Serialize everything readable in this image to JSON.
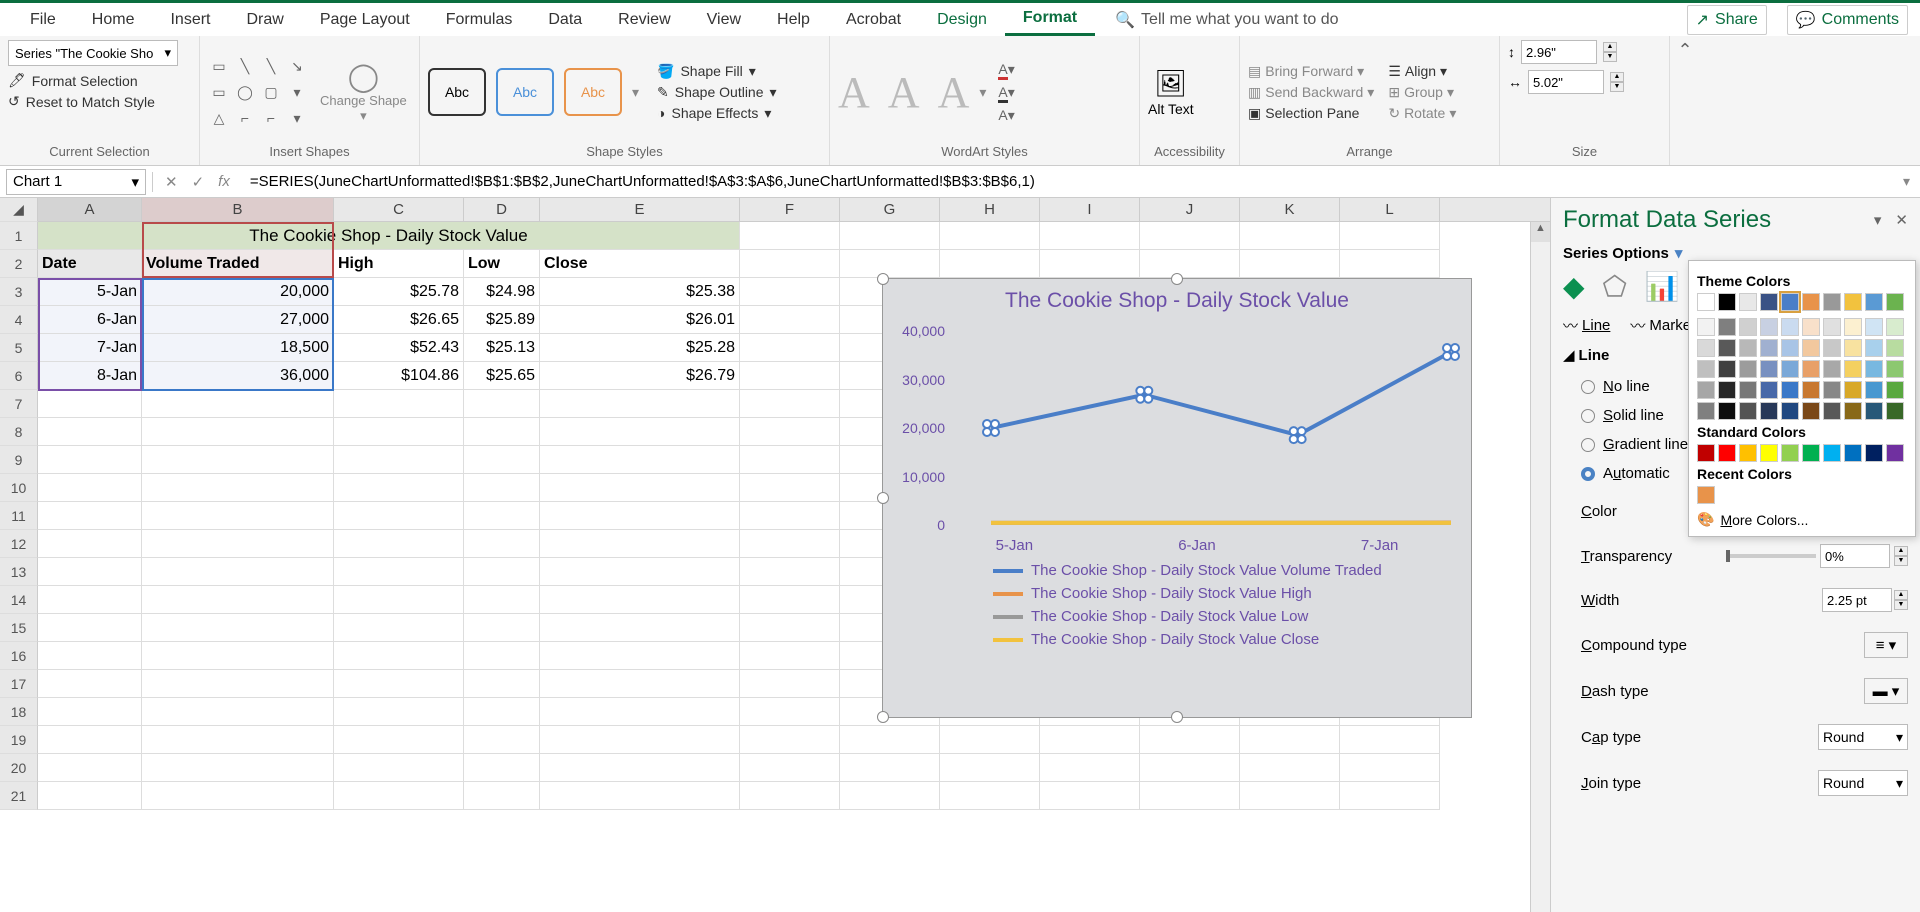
{
  "menu": {
    "items": [
      "File",
      "Home",
      "Insert",
      "Draw",
      "Page Layout",
      "Formulas",
      "Data",
      "Review",
      "View",
      "Help",
      "Acrobat",
      "Design",
      "Format"
    ],
    "tell_me": "Tell me what you want to do",
    "share": "Share",
    "comments": "Comments"
  },
  "ribbon": {
    "current_selection": {
      "label": "Current Selection",
      "dropdown": "Series \"The Cookie Sho",
      "format": "Format Selection",
      "reset": "Reset to Match Style"
    },
    "insert_shapes": {
      "label": "Insert Shapes",
      "change": "Change Shape"
    },
    "shape_styles": {
      "label": "Shape Styles",
      "abc": "Abc",
      "fill": "Shape Fill",
      "outline": "Shape Outline",
      "effects": "Shape Effects"
    },
    "wordart": {
      "label": "WordArt Styles"
    },
    "accessibility": {
      "label": "Accessibility",
      "alt": "Alt Text"
    },
    "arrange": {
      "label": "Arrange",
      "forward": "Bring Forward",
      "backward": "Send Backward",
      "pane": "Selection Pane",
      "align": "Align",
      "group": "Group",
      "rotate": "Rotate"
    },
    "size": {
      "label": "Size",
      "height": "2.96\"",
      "width": "5.02\""
    }
  },
  "name_box": "Chart 1",
  "formula": "=SERIES(JuneChartUnformatted!$B$1:$B$2,JuneChartUnformatted!$A$3:$A$6,JuneChartUnformatted!$B$3:$B$6,1)",
  "columns": [
    "A",
    "B",
    "C",
    "D",
    "E",
    "F",
    "G",
    "H",
    "I",
    "J",
    "K",
    "L"
  ],
  "sheet": {
    "title": "The Cookie Shop - Daily Stock Value",
    "headers": {
      "date": "Date",
      "vol": "Volume Traded",
      "high": "High",
      "low": "Low",
      "close": "Close"
    },
    "rows": [
      {
        "date": "5-Jan",
        "vol": "20,000",
        "high": "$25.78",
        "low": "$24.98",
        "close": "$25.38"
      },
      {
        "date": "6-Jan",
        "vol": "27,000",
        "high": "$26.65",
        "low": "$25.89",
        "close": "$26.01"
      },
      {
        "date": "7-Jan",
        "vol": "18,500",
        "high": "$52.43",
        "low": "$25.13",
        "close": "$25.28"
      },
      {
        "date": "8-Jan",
        "vol": "36,000",
        "high": "$104.86",
        "low": "$25.65",
        "close": "$26.79"
      }
    ]
  },
  "chart_data": {
    "type": "line",
    "title": "The Cookie Shop - Daily Stock Value",
    "categories": [
      "5-Jan",
      "6-Jan",
      "7-Jan",
      "8-Jan"
    ],
    "series": [
      {
        "name": "The Cookie Shop - Daily Stock Value Volume Traded",
        "values": [
          20000,
          27000,
          18500,
          36000
        ],
        "color": "#4a7ec8"
      },
      {
        "name": "The Cookie Shop - Daily Stock Value High",
        "values": [
          25.78,
          26.65,
          52.43,
          104.86
        ],
        "color": "#e8934a"
      },
      {
        "name": "The Cookie Shop - Daily Stock Value Low",
        "values": [
          24.98,
          25.89,
          25.13,
          25.65
        ],
        "color": "#999"
      },
      {
        "name": "The Cookie Shop - Daily Stock Value Close",
        "values": [
          25.38,
          26.01,
          25.28,
          26.79
        ],
        "color": "#f2c23e"
      }
    ],
    "ylim": [
      0,
      40000
    ],
    "yticks": [
      "40,000",
      "30,000",
      "20,000",
      "10,000",
      "0"
    ],
    "xlabel": "",
    "ylabel": ""
  },
  "pane": {
    "title": "Format Data Series",
    "opts": "Series Options",
    "tab_line": "Line",
    "tab_marker": "Marker",
    "section": "Line",
    "r_noline": "No line",
    "r_solid": "Solid line",
    "r_grad": "Gradient line",
    "r_auto": "Automatic",
    "color": "Color",
    "transp": "Transparency",
    "transp_v": "0%",
    "width": "Width",
    "width_v": "2.25 pt",
    "compound": "Compound type",
    "dash": "Dash type",
    "cap": "Cap type",
    "round": "Round",
    "join": "Join type"
  },
  "picker": {
    "theme": "Theme Colors",
    "standard": "Standard Colors",
    "recent": "Recent Colors",
    "more": "More Colors..."
  }
}
